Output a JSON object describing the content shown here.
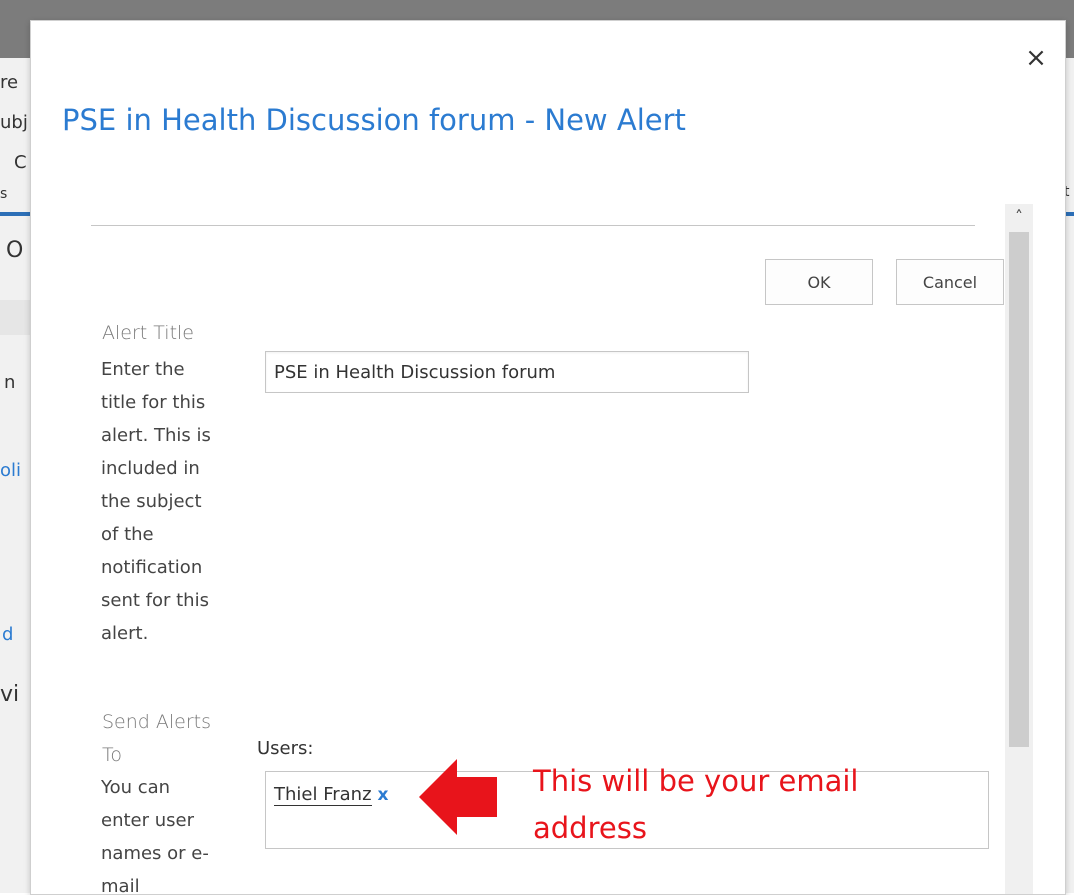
{
  "background": {
    "fragments": [
      "re",
      "ubj",
      "C",
      "s",
      "O",
      "n",
      "oli",
      "d",
      "vi",
      "t"
    ]
  },
  "dialog": {
    "title": "PSE in Health Discussion forum - New Alert",
    "close_glyph": "×",
    "ok_label": "OK",
    "cancel_label": "Cancel"
  },
  "alert_title_section": {
    "title": "Alert Title",
    "description": "Enter the title for this alert. This is included in the subject of the notification sent for this alert.",
    "input_value": "PSE in Health Discussion forum"
  },
  "send_alerts_section": {
    "title": "Send Alerts To",
    "description": "You can enter user names or e-mail",
    "users_label": "Users:",
    "user_name": "Thiel Franz",
    "remove_glyph": "x"
  },
  "annotation": {
    "text": "This will be your email address",
    "color": "#e8141b"
  },
  "icons": {
    "close": "close-icon",
    "scroll_up": "chevron-up-icon",
    "arrow": "arrow-left-icon"
  }
}
